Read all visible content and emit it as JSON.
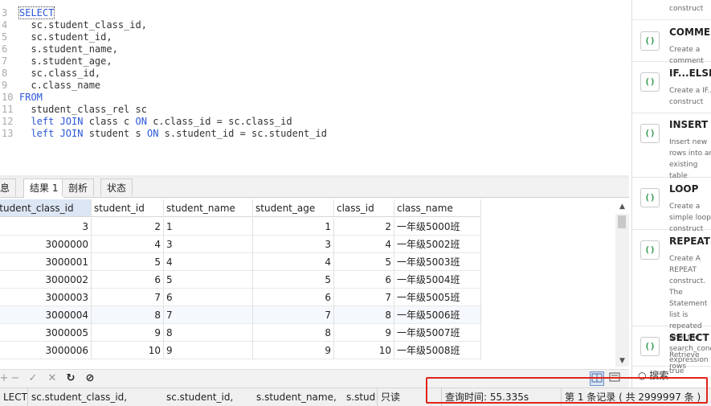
{
  "editor": {
    "lines": [
      {
        "n": "3",
        "tokens": [
          {
            "t": "SELECT",
            "kw": true
          }
        ]
      },
      {
        "n": "4",
        "tokens": [
          {
            "t": "  sc.student_class_id,",
            "kw": false
          }
        ]
      },
      {
        "n": "5",
        "tokens": [
          {
            "t": "  sc.student_id,",
            "kw": false
          }
        ]
      },
      {
        "n": "6",
        "tokens": [
          {
            "t": "  s.student_name,",
            "kw": false
          }
        ]
      },
      {
        "n": "7",
        "tokens": [
          {
            "t": "  s.student_age,",
            "kw": false
          }
        ]
      },
      {
        "n": "8",
        "tokens": [
          {
            "t": "  sc.class_id,",
            "kw": false
          }
        ]
      },
      {
        "n": "9",
        "tokens": [
          {
            "t": "  c.class_name",
            "kw": false
          }
        ]
      },
      {
        "n": "10",
        "tokens": [
          {
            "t": "FROM",
            "kw": true
          }
        ]
      },
      {
        "n": "11",
        "tokens": [
          {
            "t": "  student_class_rel sc",
            "kw": false
          }
        ]
      },
      {
        "n": "12",
        "tokens": [
          {
            "t": "  ",
            "kw": false
          },
          {
            "t": "left JOIN",
            "kw": true
          },
          {
            "t": " class c ",
            "kw": false
          },
          {
            "t": "ON",
            "kw": true
          },
          {
            "t": " c.class_id = sc.class_id",
            "kw": false
          }
        ]
      },
      {
        "n": "13",
        "tokens": [
          {
            "t": "  ",
            "kw": false
          },
          {
            "t": "left JOIN",
            "kw": true
          },
          {
            "t": " student s ",
            "kw": false
          },
          {
            "t": "ON",
            "kw": true
          },
          {
            "t": " s.student_id = sc.student_id",
            "kw": false
          }
        ]
      }
    ]
  },
  "tabs": [
    "息",
    "结果 1",
    "剖析",
    "状态"
  ],
  "grid": {
    "columns": [
      "student_class_id",
      "student_id",
      "student_name",
      "student_age",
      "class_id",
      "class_name"
    ],
    "rows": [
      [
        "3",
        "2",
        "1",
        "1",
        "2",
        "一年级5000班"
      ],
      [
        "3000000",
        "4",
        "3",
        "3",
        "4",
        "一年级5002班"
      ],
      [
        "3000001",
        "5",
        "4",
        "4",
        "5",
        "一年级5003班"
      ],
      [
        "3000002",
        "6",
        "5",
        "5",
        "6",
        "一年级5004班"
      ],
      [
        "3000003",
        "7",
        "6",
        "6",
        "7",
        "一年级5005班"
      ],
      [
        "3000004",
        "8",
        "7",
        "7",
        "8",
        "一年级5006班"
      ],
      [
        "3000005",
        "9",
        "8",
        "8",
        "9",
        "一年级5007班"
      ],
      [
        "3000006",
        "10",
        "9",
        "9",
        "10",
        "一年级5008班"
      ]
    ]
  },
  "toolbar": {
    "add": "+",
    "remove": "−",
    "apply": "✓",
    "discard": "✕",
    "refresh": "↻",
    "stop": "⊘"
  },
  "status": {
    "query_prefix": "LECT",
    "col1": "sc.student_class_id,",
    "col2": "sc.student_id,",
    "col3": "s.student_name,",
    "col4": "s.stud",
    "readonly": "只读",
    "query_time": "查询时间: 55.335s",
    "record": "第 1 条记录 ( 共 2999997 条 )"
  },
  "panel": {
    "top_desc": "construct",
    "snippets": [
      {
        "title": "COMMENT",
        "desc": "Create a comment"
      },
      {
        "title": "IF...ELSE...",
        "desc": "Create a IF... construct"
      },
      {
        "title": "INSERT S",
        "desc": "Insert new rows into an existing table"
      },
      {
        "title": "LOOP",
        "desc": "Create a simple loop construct"
      },
      {
        "title": "REPEAT",
        "desc": "Create A REPEAT construct. The Statement list is repeated until the search_condition expression is true"
      },
      {
        "title": "SELECT S",
        "desc": "Retrieve rows"
      }
    ],
    "search": "搜索"
  },
  "colors": {
    "keyword": "#2b57d9",
    "highlight_box": "#e0241b",
    "header_selected": "#dce6f4"
  }
}
